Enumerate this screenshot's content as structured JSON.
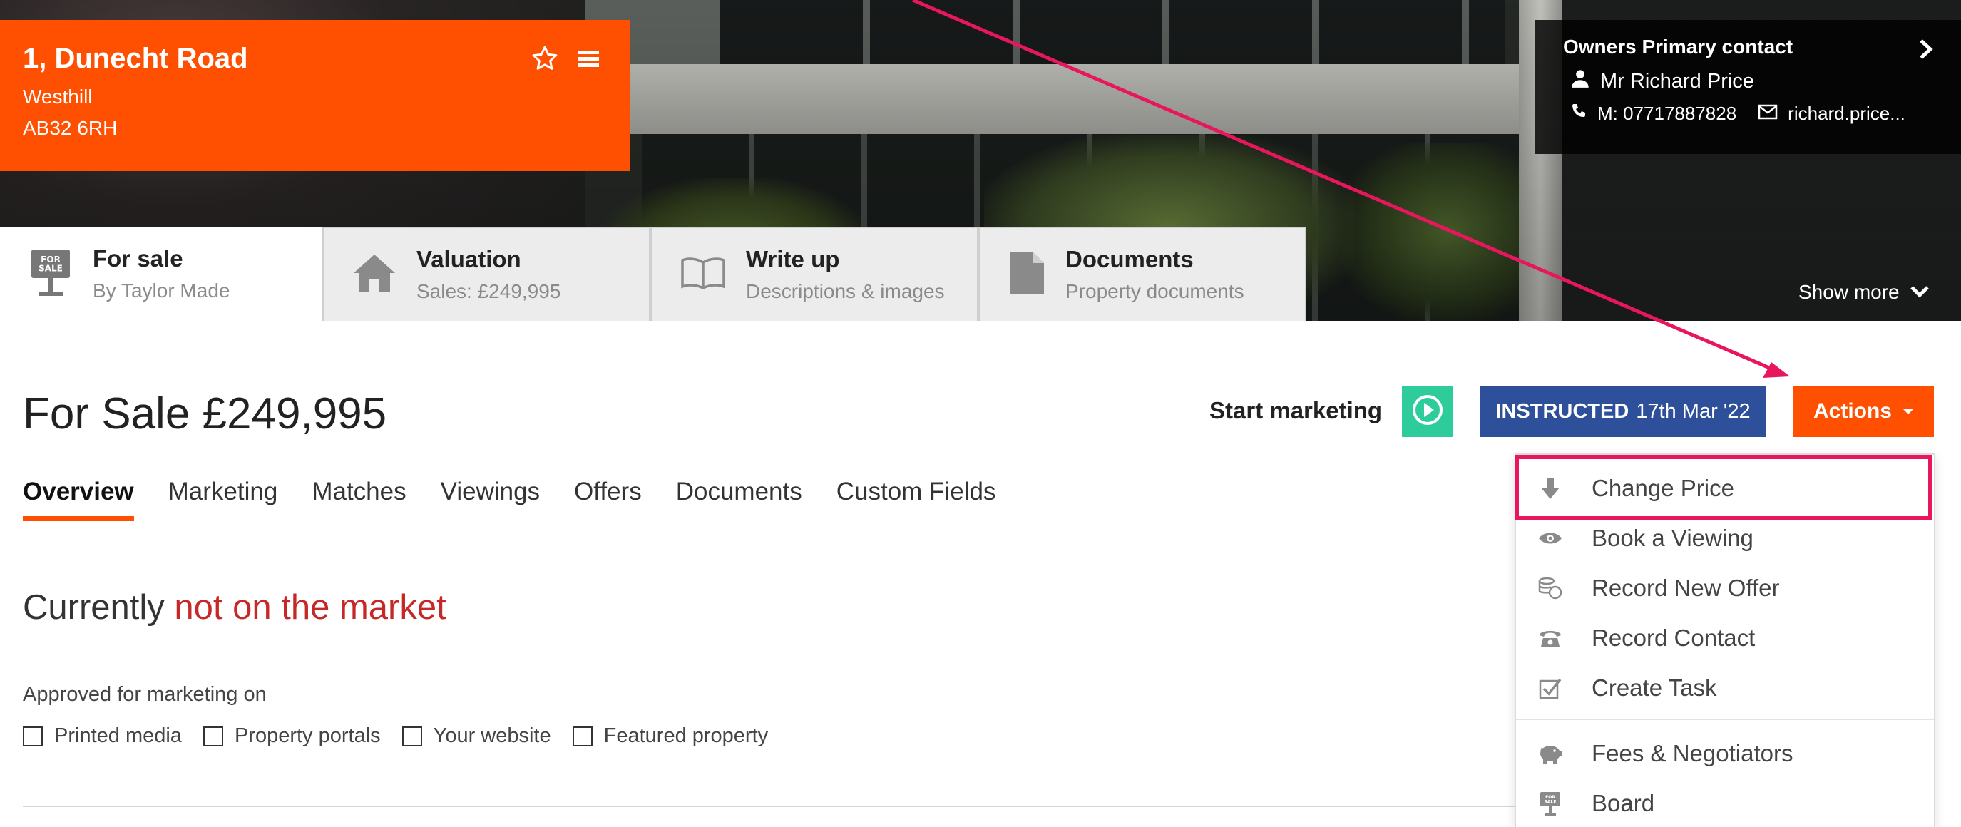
{
  "property": {
    "address_line1": "1, Dunecht Road",
    "address_line2": "Westhill",
    "address_line3": "AB32 6RH"
  },
  "owner": {
    "title": "Owners Primary contact",
    "name": "Mr Richard Price",
    "mobile": "M: 07717887828",
    "email": "richard.price..."
  },
  "hero": {
    "show_more": "Show more"
  },
  "top_tabs": [
    {
      "title": "For sale",
      "subtitle": "By Taylor Made",
      "icon": "for-sale-sign-icon",
      "board_text": "FOR SALE"
    },
    {
      "title": "Valuation",
      "subtitle": "Sales: £249,995",
      "icon": "house-icon"
    },
    {
      "title": "Write up",
      "subtitle": "Descriptions & images",
      "icon": "book-icon"
    },
    {
      "title": "Documents",
      "subtitle": "Property documents",
      "icon": "document-icon"
    }
  ],
  "price_heading": "For Sale £249,995",
  "start_marketing": "Start marketing",
  "instructed": {
    "label": "INSTRUCTED",
    "date": "17th Mar '22"
  },
  "actions_label": "Actions",
  "sub_tabs": [
    {
      "label": "Overview",
      "active": true
    },
    {
      "label": "Marketing"
    },
    {
      "label": "Matches"
    },
    {
      "label": "Viewings"
    },
    {
      "label": "Offers"
    },
    {
      "label": "Documents"
    },
    {
      "label": "Custom Fields"
    }
  ],
  "market_status": {
    "prefix": "Currently",
    "status": "not on the market"
  },
  "approved": {
    "label": "Approved for marketing on",
    "options": [
      "Printed media",
      "Property portals",
      "Your website",
      "Featured property"
    ]
  },
  "actions_menu": [
    {
      "label": "Change Price",
      "icon": "arrow-down-icon",
      "highlighted": true
    },
    {
      "label": "Book a Viewing",
      "icon": "eye-icon"
    },
    {
      "label": "Record New Offer",
      "icon": "coins-icon"
    },
    {
      "label": "Record Contact",
      "icon": "phone-icon"
    },
    {
      "label": "Create Task",
      "icon": "checkbox-icon"
    },
    {
      "label": "Fees & Negotiators",
      "icon": "piggy-bank-icon"
    },
    {
      "label": "Board",
      "icon": "sign-board-icon"
    }
  ],
  "colors": {
    "brand_orange": "#fe5000",
    "instructed_blue": "#2e4f9a",
    "play_green": "#2ecc9a",
    "status_red": "#c62828",
    "annotation_pink": "#e8175d"
  }
}
